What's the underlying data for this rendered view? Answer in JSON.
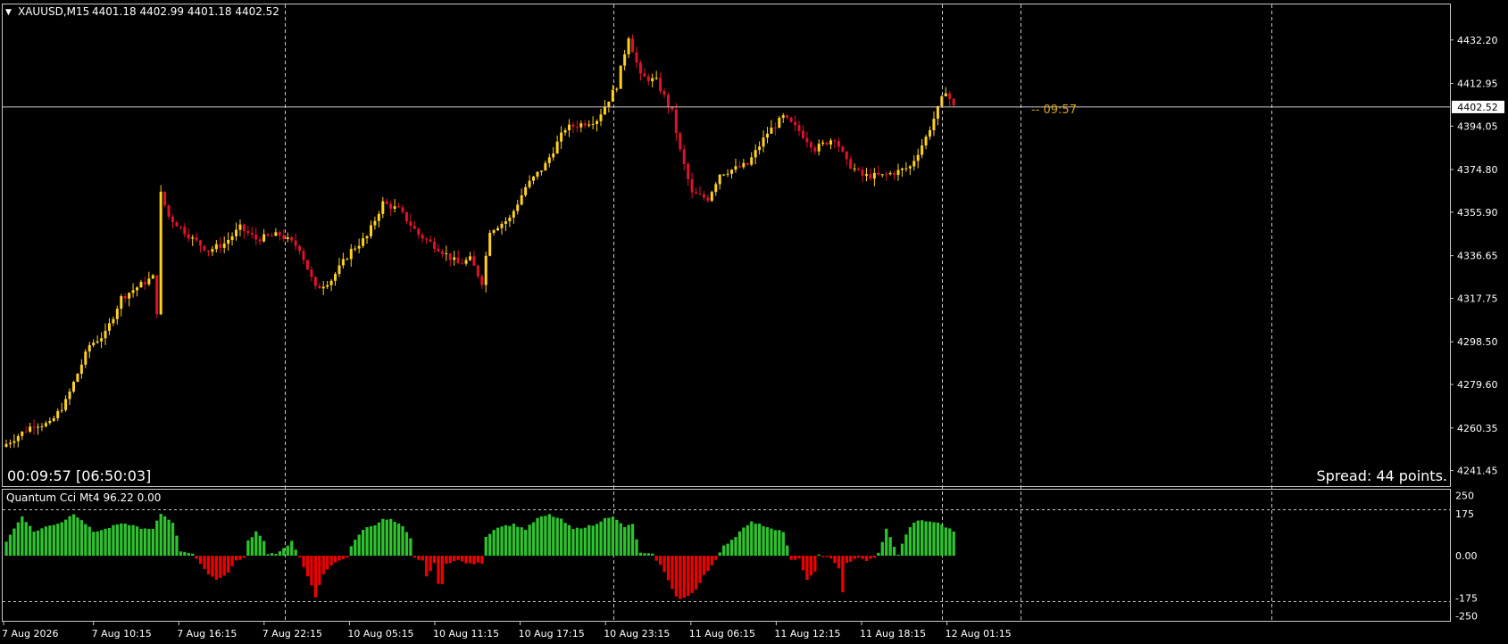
{
  "colors": {
    "background": "#000000",
    "grid": "#c8c8c8",
    "bull_candle": "#ffd21e",
    "bear_candle": "#e0112b",
    "cci_positive": "#2fc22f",
    "cci_negative": "#ee0000",
    "countdown": "#d6a21c",
    "text": "#ffffff"
  },
  "chart": {
    "header_arrow": "▼",
    "symbol_label": "XAUUSD,M15",
    "ohlc_label": "4401.18 4402.99 4401.18 4402.52",
    "timer_label": "00:09:57 [06:50:03]",
    "spread_label": "Spread: 44 points.",
    "bid_label": "4402.52",
    "bid_value": 4402.52,
    "countdown_label": "-- 09:57",
    "price_axis": [
      "4432.20",
      "4412.95",
      "4394.05",
      "4374.80",
      "4355.90",
      "4336.65",
      "4317.75",
      "4298.50",
      "4279.60",
      "4260.35",
      "4241.45"
    ],
    "price_range": [
      4240.5,
      4442
    ],
    "time_axis": [
      "7 Aug 2026",
      "7 Aug 10:15",
      "7 Aug 16:15",
      "7 Aug 22:15",
      "10 Aug 05:15",
      "10 Aug 11:15",
      "10 Aug 17:15",
      "10 Aug 23:15",
      "11 Aug 06:15",
      "11 Aug 12:15",
      "11 Aug 18:15",
      "12 Aug 01:15"
    ],
    "candle_count": 240,
    "price_path": [
      [
        0,
        4252
      ],
      [
        8,
        4262
      ],
      [
        12,
        4262
      ],
      [
        16,
        4272
      ],
      [
        22,
        4297
      ],
      [
        26,
        4302
      ],
      [
        30,
        4318
      ],
      [
        36,
        4325
      ],
      [
        38,
        4327
      ],
      [
        39,
        4312
      ],
      [
        40,
        4364
      ],
      [
        42,
        4354
      ],
      [
        48,
        4344
      ],
      [
        52,
        4339
      ],
      [
        56,
        4342
      ],
      [
        60,
        4349
      ],
      [
        64,
        4344
      ],
      [
        70,
        4346
      ],
      [
        75,
        4340
      ],
      [
        79,
        4322
      ],
      [
        83,
        4326
      ],
      [
        88,
        4339
      ],
      [
        92,
        4345
      ],
      [
        96,
        4360
      ],
      [
        100,
        4357
      ],
      [
        105,
        4346
      ],
      [
        110,
        4340
      ],
      [
        115,
        4333
      ],
      [
        118,
        4335
      ],
      [
        121,
        4325
      ],
      [
        123,
        4348
      ],
      [
        128,
        4353
      ],
      [
        132,
        4367
      ],
      [
        137,
        4377
      ],
      [
        142,
        4393
      ],
      [
        150,
        4397
      ],
      [
        155,
        4412
      ],
      [
        158,
        4434
      ],
      [
        161,
        4416
      ],
      [
        165,
        4414
      ],
      [
        169,
        4400
      ],
      [
        171,
        4383
      ],
      [
        174,
        4364
      ],
      [
        178,
        4362
      ],
      [
        181,
        4373
      ],
      [
        188,
        4377
      ],
      [
        193,
        4391
      ],
      [
        197,
        4398
      ],
      [
        201,
        4392
      ],
      [
        205,
        4384
      ],
      [
        210,
        4389
      ],
      [
        213,
        4378
      ],
      [
        217,
        4372
      ],
      [
        222,
        4372
      ],
      [
        226,
        4374
      ],
      [
        229,
        4376
      ],
      [
        233,
        4389
      ],
      [
        238,
        4410
      ],
      [
        240,
        4402.5
      ]
    ]
  },
  "indicator": {
    "label": "Quantum Cci Mt4 96.22 0.00",
    "axis": [
      "250",
      "175",
      "0.00",
      "-175",
      "-250"
    ],
    "levels": [
      175,
      -175
    ],
    "range": [
      -255,
      255
    ],
    "cci_path": [
      [
        0,
        60
      ],
      [
        4,
        165
      ],
      [
        7,
        100
      ],
      [
        10,
        120
      ],
      [
        14,
        140
      ],
      [
        17,
        175
      ],
      [
        19,
        150
      ],
      [
        22,
        100
      ],
      [
        25,
        110
      ],
      [
        28,
        130
      ],
      [
        31,
        130
      ],
      [
        35,
        110
      ],
      [
        37,
        110
      ],
      [
        39,
        175
      ],
      [
        42,
        140
      ],
      [
        44,
        20
      ],
      [
        47,
        10
      ],
      [
        50,
        -60
      ],
      [
        53,
        -100
      ],
      [
        56,
        -70
      ],
      [
        58,
        -20
      ],
      [
        60,
        -10
      ],
      [
        61,
        60
      ],
      [
        63,
        100
      ],
      [
        65,
        60
      ],
      [
        66,
        10
      ],
      [
        68,
        10
      ],
      [
        70,
        30
      ],
      [
        72,
        60
      ],
      [
        74,
        -10
      ],
      [
        75,
        -50
      ],
      [
        77,
        -120
      ],
      [
        78,
        -170
      ],
      [
        80,
        -80
      ],
      [
        82,
        -40
      ],
      [
        84,
        -20
      ],
      [
        86,
        -5
      ],
      [
        87,
        40
      ],
      [
        90,
        110
      ],
      [
        93,
        130
      ],
      [
        95,
        150
      ],
      [
        97,
        150
      ],
      [
        100,
        120
      ],
      [
        102,
        70
      ],
      [
        103,
        -10
      ],
      [
        105,
        -20
      ],
      [
        106,
        -90
      ],
      [
        108,
        -30
      ],
      [
        109,
        -120
      ],
      [
        110,
        -120
      ],
      [
        111,
        -30
      ],
      [
        114,
        -20
      ],
      [
        117,
        -35
      ],
      [
        120,
        -30
      ],
      [
        121,
        80
      ],
      [
        124,
        120
      ],
      [
        128,
        130
      ],
      [
        131,
        110
      ],
      [
        134,
        155
      ],
      [
        137,
        170
      ],
      [
        140,
        150
      ],
      [
        143,
        110
      ],
      [
        146,
        120
      ],
      [
        149,
        130
      ],
      [
        151,
        160
      ],
      [
        153,
        160
      ],
      [
        156,
        120
      ],
      [
        158,
        130
      ],
      [
        160,
        10
      ],
      [
        163,
        5
      ],
      [
        165,
        -40
      ],
      [
        167,
        -100
      ],
      [
        169,
        -170
      ],
      [
        170,
        -180
      ],
      [
        172,
        -170
      ],
      [
        174,
        -140
      ],
      [
        176,
        -80
      ],
      [
        179,
        -20
      ],
      [
        181,
        40
      ],
      [
        184,
        80
      ],
      [
        186,
        120
      ],
      [
        188,
        140
      ],
      [
        190,
        130
      ],
      [
        193,
        115
      ],
      [
        196,
        100
      ],
      [
        198,
        -20
      ],
      [
        200,
        -15
      ],
      [
        202,
        -100
      ],
      [
        204,
        -70
      ],
      [
        205,
        5
      ],
      [
        208,
        -15
      ],
      [
        210,
        -50
      ],
      [
        211,
        -150
      ],
      [
        212,
        -30
      ],
      [
        215,
        -10
      ],
      [
        217,
        -20
      ],
      [
        219,
        -10
      ],
      [
        220,
        10
      ],
      [
        222,
        110
      ],
      [
        224,
        40
      ],
      [
        225,
        5
      ],
      [
        227,
        90
      ],
      [
        229,
        140
      ],
      [
        231,
        145
      ],
      [
        234,
        140
      ],
      [
        236,
        130
      ],
      [
        238,
        110
      ],
      [
        240,
        95
      ]
    ]
  }
}
